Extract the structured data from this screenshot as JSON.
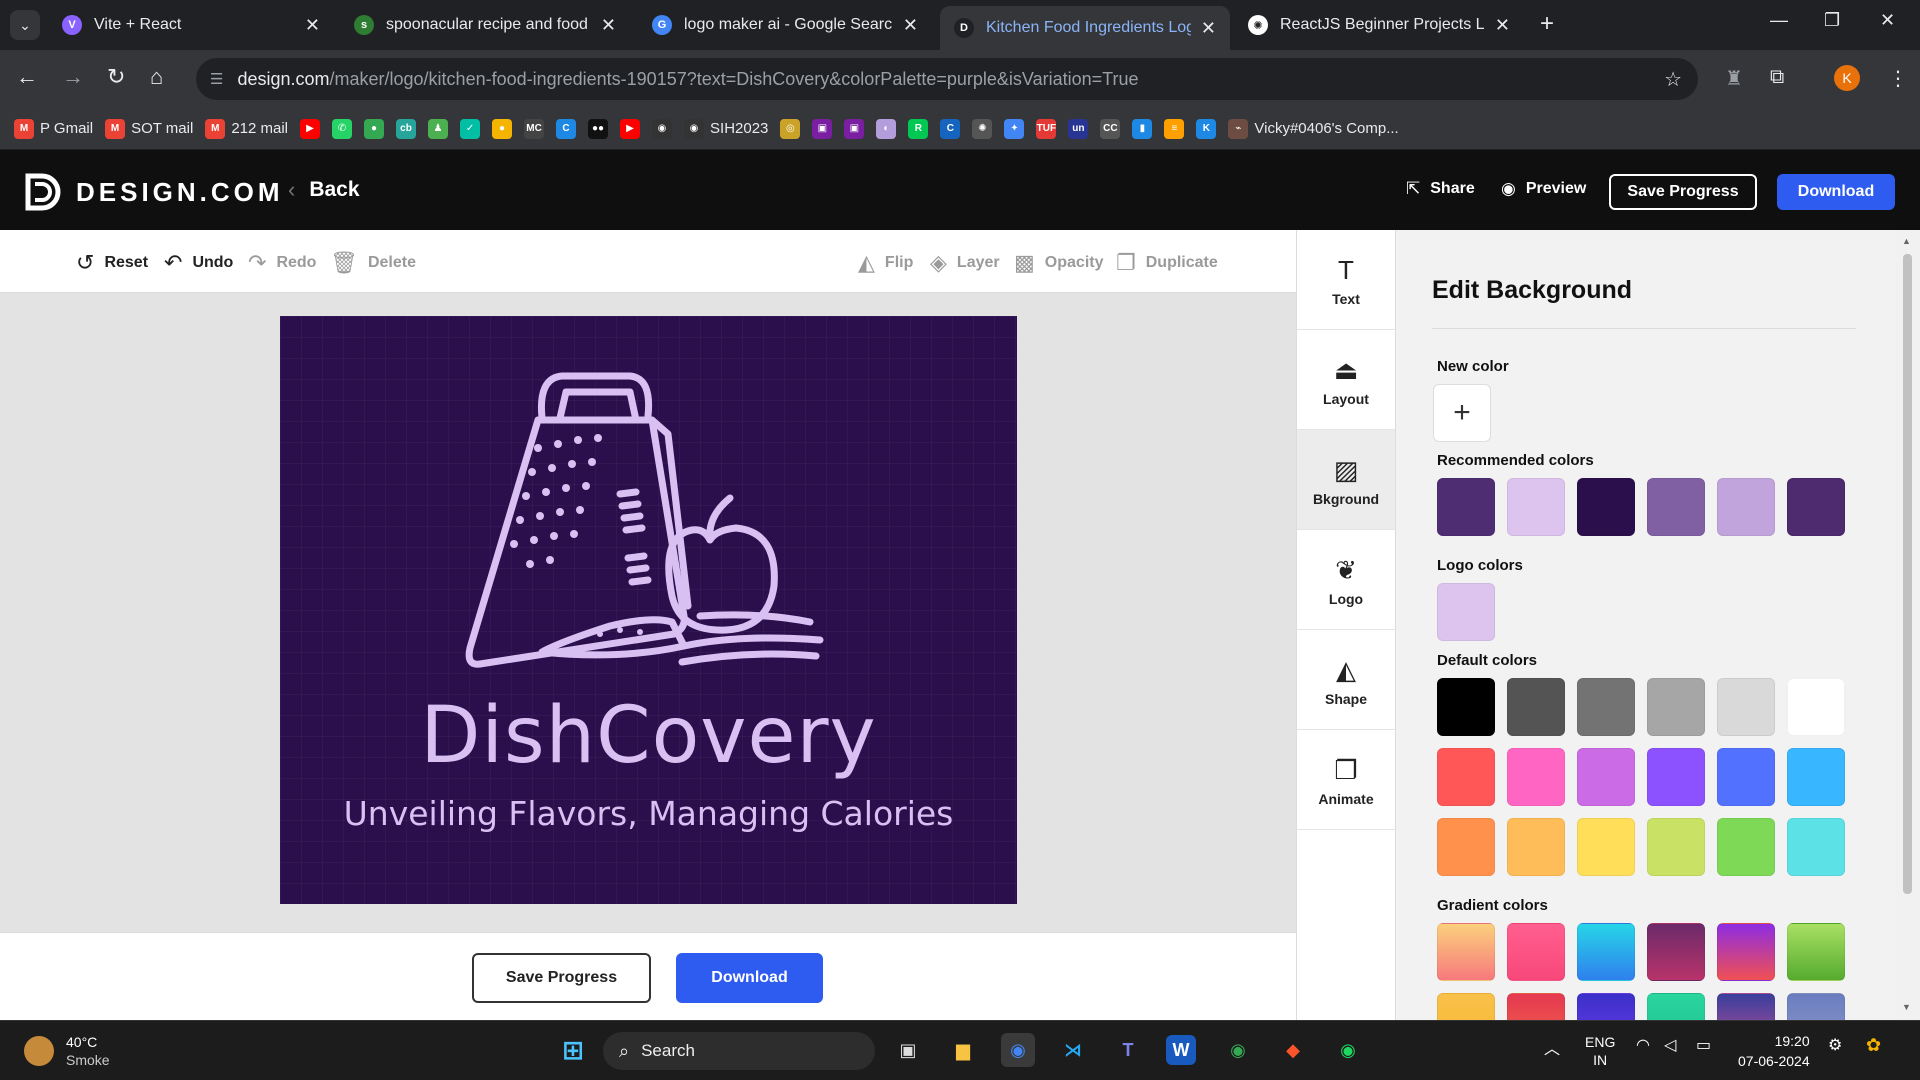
{
  "browser": {
    "tabs": [
      {
        "title": "Vite + React",
        "fav_color": "#8a63ff",
        "fav_glyph": "V"
      },
      {
        "title": "spoonacular recipe and food AI",
        "fav_color": "#2e7d32",
        "fav_glyph": "s"
      },
      {
        "title": "logo maker ai - Google Search",
        "fav_color": "#4285f4",
        "fav_glyph": "G"
      },
      {
        "title": "Kitchen Food Ingredients Logo",
        "fav_color": "#202124",
        "fav_glyph": "D",
        "active": true
      },
      {
        "title": "ReactJS Beginner Projects List",
        "fav_color": "#ffffff",
        "fav_glyph": "✺"
      }
    ],
    "new_tab": "+",
    "address": {
      "domain": "design.com",
      "path": "/maker/logo/kitchen-food-ingredients-190157?text=DishCovery&colorPalette=purple&isVariation=True"
    },
    "profile_initial": "K",
    "bookmarks": [
      {
        "label": "P Gmail",
        "color": "#ea4335",
        "glyph": "M"
      },
      {
        "label": "SOT mail",
        "color": "#ea4335",
        "glyph": "M"
      },
      {
        "label": "212 mail",
        "color": "#ea4335",
        "glyph": "M"
      },
      {
        "label": "",
        "color": "#ff0000",
        "glyph": "▶"
      },
      {
        "label": "",
        "color": "#25d366",
        "glyph": "✆"
      },
      {
        "label": "",
        "color": "#34a853",
        "glyph": "●"
      },
      {
        "label": "",
        "color": "#26a69a",
        "glyph": "cb"
      },
      {
        "label": "",
        "color": "#4caf50",
        "glyph": "♟"
      },
      {
        "label": "",
        "color": "#00bfa5",
        "glyph": "✓"
      },
      {
        "label": "",
        "color": "#f4b400",
        "glyph": "●"
      },
      {
        "label": "",
        "color": "#444444",
        "glyph": "MC"
      },
      {
        "label": "",
        "color": "#1e88e5",
        "glyph": "C"
      },
      {
        "label": "",
        "color": "#111111",
        "glyph": "●●"
      },
      {
        "label": "",
        "color": "#ff0000",
        "glyph": "▶"
      },
      {
        "label": "",
        "color": "#333333",
        "glyph": "◉"
      },
      {
        "label": "SIH2023",
        "color": "#333333",
        "glyph": "◉"
      },
      {
        "label": "",
        "color": "#c9a227",
        "glyph": "◎"
      },
      {
        "label": "",
        "color": "#7b1fa2",
        "glyph": "▣"
      },
      {
        "label": "",
        "color": "#7b1fa2",
        "glyph": "▣"
      },
      {
        "label": "",
        "color": "#b39ddb",
        "glyph": "◐"
      },
      {
        "label": "",
        "color": "#00c853",
        "glyph": "R"
      },
      {
        "label": "",
        "color": "#1565c0",
        "glyph": "C"
      },
      {
        "label": "",
        "color": "#555555",
        "glyph": "✺"
      },
      {
        "label": "",
        "color": "#4285f4",
        "glyph": "✦"
      },
      {
        "label": "",
        "color": "#e53935",
        "glyph": "TUF"
      },
      {
        "label": "",
        "color": "#283593",
        "glyph": "un"
      },
      {
        "label": "",
        "color": "#555555",
        "glyph": "CC"
      },
      {
        "label": "",
        "color": "#1e88e5",
        "glyph": "▮"
      },
      {
        "label": "",
        "color": "#ffa000",
        "glyph": "≡"
      },
      {
        "label": "",
        "color": "#1e88e5",
        "glyph": "K"
      },
      {
        "label": "Vicky#0406's Comp...",
        "color": "#6d4c41",
        "glyph": "⌁"
      }
    ]
  },
  "app": {
    "brand": "DESIGN.COM",
    "back_label": "Back",
    "share_label": "Share",
    "preview_label": "Preview",
    "save_progress_label": "Save Progress",
    "download_label": "Download"
  },
  "toolbar": {
    "reset": "Reset",
    "undo": "Undo",
    "redo": "Redo",
    "delete": "Delete",
    "flip": "Flip",
    "layer": "Layer",
    "opacity": "Opacity",
    "duplicate": "Duplicate"
  },
  "logo": {
    "title": "DishCovery",
    "tagline": "Unveiling Flavors, Managing Calories",
    "background": "#2b0f4c",
    "art_color": "#d8c1f2"
  },
  "side_tools": [
    {
      "label": "Text",
      "icon": "text-icon",
      "glyph": "T"
    },
    {
      "label": "Layout",
      "icon": "layout-icon",
      "glyph": "⏏"
    },
    {
      "label": "Bkground",
      "icon": "background-icon",
      "glyph": "▨",
      "active": true
    },
    {
      "label": "Logo",
      "icon": "logo-icon",
      "glyph": "❦"
    },
    {
      "label": "Shape",
      "icon": "shape-icon",
      "glyph": "◭"
    },
    {
      "label": "Animate",
      "icon": "animate-icon",
      "glyph": "❐"
    }
  ],
  "panel": {
    "title": "Edit Background",
    "new_color_label": "New color",
    "recommended_label": "Recommended colors",
    "recommended": [
      "#4e2d73",
      "#dcc4ef",
      "#2b0f4c",
      "#8060a3",
      "#c1a4dc",
      "#4e2a6e"
    ],
    "logo_colors_label": "Logo colors",
    "logo_colors": [
      "#dcc4ef"
    ],
    "default_label": "Default colors",
    "default_rows": [
      [
        "#000000",
        "#545454",
        "#737373",
        "#a6a6a6",
        "#d9d9d9",
        "#ffffff"
      ],
      [
        "#ff5757",
        "#ff66c4",
        "#cb6ce6",
        "#8c52ff",
        "#5271ff",
        "#38b6ff"
      ],
      [
        "#ff914d",
        "#ffbd59",
        "#ffde59",
        "#c9e265",
        "#7ed957",
        "#5ce1e6"
      ]
    ],
    "gradient_label": "Gradient colors",
    "gradient_rows": [
      [
        "linear-gradient(180deg,#fbd07c,#f7797d)",
        "linear-gradient(180deg,#ff5f8f,#f8487a)",
        "linear-gradient(180deg,#27d5e8,#2f80ed)",
        "linear-gradient(180deg,#6c2a6a,#b8336a)",
        "linear-gradient(180deg,#8e2de2,#f05053)",
        "linear-gradient(180deg,#a8e063,#56ab2f)"
      ],
      [
        "linear-gradient(180deg,#f8c14a,#f7b733)",
        "linear-gradient(180deg,#e53950,#f0634b)",
        "linear-gradient(180deg,#3b2fc9,#6a3de8)",
        "linear-gradient(180deg,#2ad69e,#1fbf8f)",
        "linear-gradient(180deg,#3a3f9c,#b54e9a)",
        "linear-gradient(180deg,#6a7dc0,#8a98c8)"
      ]
    ]
  },
  "taskbar": {
    "temperature": "40°C",
    "condition": "Smoke",
    "search_label": "Search",
    "lang_top": "ENG",
    "lang_bottom": "IN",
    "time": "19:20",
    "date": "07-06-2024"
  }
}
